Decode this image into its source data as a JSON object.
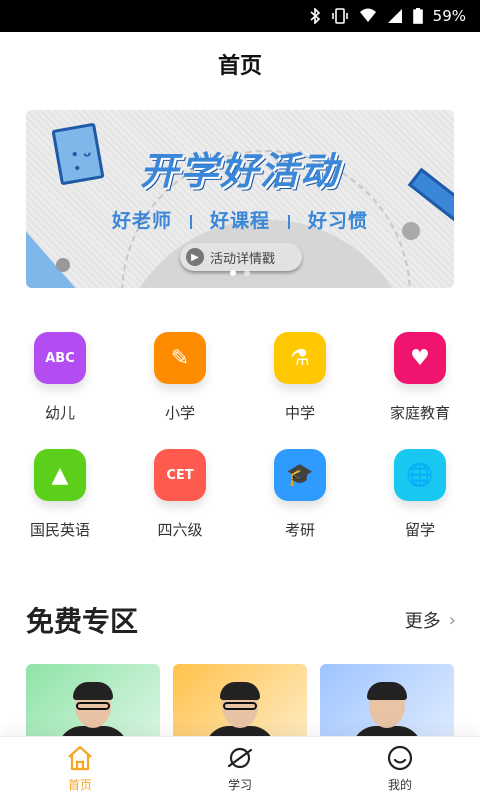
{
  "status_bar": {
    "battery": "59%",
    "icons": [
      "bluetooth-icon",
      "vibrate-icon",
      "wifi-icon",
      "signal-icon",
      "battery-icon"
    ]
  },
  "header": {
    "title": "首页"
  },
  "banner": {
    "headline": "开学好活动",
    "tags": [
      "好老师",
      "好课程",
      "好习惯"
    ],
    "button_label": "活动详情戳",
    "page_count": 2,
    "active_page": 1
  },
  "categories": [
    {
      "label": "幼儿",
      "icon": "abc-blocks-icon",
      "glyph": "ABC",
      "color": "#b34df2"
    },
    {
      "label": "小学",
      "icon": "pen-icon",
      "glyph": "✎",
      "color": "#ff8c00"
    },
    {
      "label": "中学",
      "icon": "flask-icon",
      "glyph": "⚗",
      "color": "#ffc800"
    },
    {
      "label": "家庭教育",
      "icon": "home-heart-icon",
      "glyph": "♥",
      "color": "#f0146e"
    },
    {
      "label": "国民英语",
      "icon": "mountain-icon",
      "glyph": "▲",
      "color": "#5ccf1a"
    },
    {
      "label": "四六级",
      "icon": "cet-icon",
      "glyph": "CET",
      "color": "#ff5a50"
    },
    {
      "label": "考研",
      "icon": "graduation-cap-icon",
      "glyph": "🎓",
      "color": "#2f9bff"
    },
    {
      "label": "留学",
      "icon": "globe-icon",
      "glyph": "🌐",
      "color": "#18c8f0"
    }
  ],
  "free_zone": {
    "title": "免费专区",
    "more_label": "更多",
    "cards": [
      {
        "bg": "#8fe3a8",
        "glasses": true
      },
      {
        "bg": "#ffc24a",
        "glasses": true
      },
      {
        "bg": "#9ec4ff",
        "glasses": false
      }
    ]
  },
  "tabbar": {
    "accent": "#f5a623",
    "tabs": [
      {
        "label": "首页",
        "icon": "home-icon",
        "active": true
      },
      {
        "label": "学习",
        "icon": "planet-icon",
        "active": false
      },
      {
        "label": "我的",
        "icon": "smiley-icon",
        "active": false
      }
    ]
  }
}
